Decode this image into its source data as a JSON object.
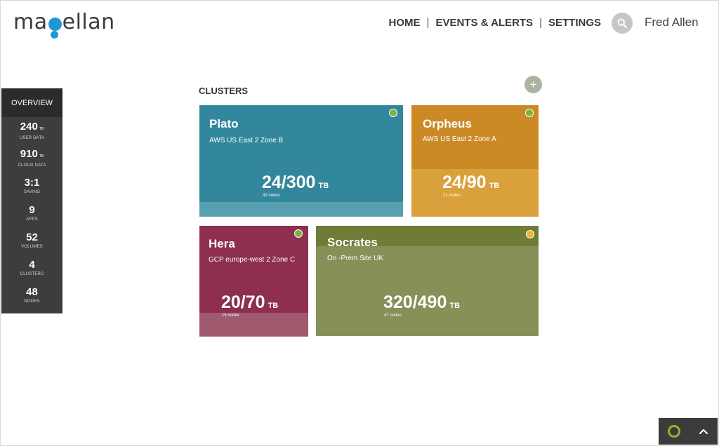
{
  "header": {
    "logo_text_a": "ma",
    "logo_text_b": "ellan",
    "nav": [
      "HOME",
      "EVENTS & ALERTS",
      "SETTINGS"
    ],
    "separator": "|",
    "user_name": "Fred Allen"
  },
  "overview": {
    "title": "OVERVIEW",
    "stats": [
      {
        "value": "240",
        "unit": "TB",
        "label": "USER DATA"
      },
      {
        "value": "910",
        "unit": "TB",
        "label": "CLOUD DATA"
      },
      {
        "value": "3:1",
        "unit": "",
        "label": "SAVING"
      },
      {
        "value": "9",
        "unit": "",
        "label": "APPS"
      },
      {
        "value": "52",
        "unit": "",
        "label": "VOLUMES"
      },
      {
        "value": "4",
        "unit": "",
        "label": "CLUSTERS"
      },
      {
        "value": "48",
        "unit": "",
        "label": "NODES"
      }
    ]
  },
  "clusters": {
    "title": "CLUSTERS",
    "add_label": "+",
    "cards": [
      {
        "name": "Plato",
        "location": "AWS US East 2 Zone B",
        "capacity": "24/300",
        "unit": "TB",
        "nodes": "42 nodes",
        "status_color": "#7cb342"
      },
      {
        "name": "Orpheus",
        "location": "AWS US East 2 Zone A",
        "capacity": "24/90",
        "unit": "TB",
        "nodes": "21 nodes",
        "status_color": "#7cb342"
      },
      {
        "name": "Hera",
        "location": "GCP europe-west 2 Zone C",
        "capacity": "20/70",
        "unit": "TB",
        "nodes": "15 nodes",
        "status_color": "#7cb342"
      },
      {
        "name": "Socrates",
        "location": "On -Prem  Site UK",
        "capacity": "320/490",
        "unit": "TB",
        "nodes": "47 nodes",
        "status_color": "#f0b429"
      }
    ]
  },
  "widget": {
    "chevron": "^"
  }
}
